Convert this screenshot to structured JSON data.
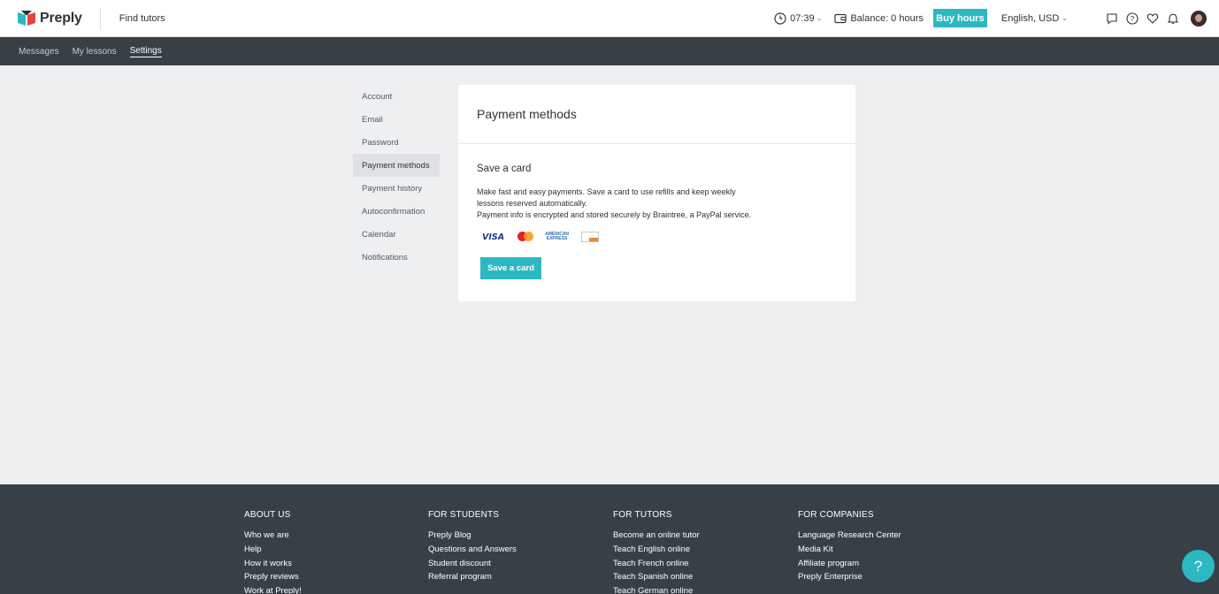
{
  "header": {
    "brand": "Preply",
    "find_tutors": "Find tutors",
    "time": "07:39",
    "balance": "Balance: 0 hours",
    "buy_hours": "Buy hours",
    "language": "English, USD"
  },
  "subnav": {
    "items": [
      "Messages",
      "My lessons",
      "Settings"
    ],
    "active": "Settings"
  },
  "sidebar": {
    "items": [
      "Account",
      "Email",
      "Password",
      "Payment methods",
      "Payment history",
      "Autoconfirmation",
      "Calendar",
      "Notifications"
    ],
    "active": "Payment methods"
  },
  "card": {
    "title": "Payment methods",
    "section_title": "Save a card",
    "description_line1": "Make fast and easy payments. Save a card to use refills and keep weekly",
    "description_line2": "lessons reserved automatically.",
    "description_line3": "Payment info is encrypted and stored securely by Braintree, a PayPal service.",
    "card_logos": [
      "VISA",
      "Mastercard",
      "American Express",
      "Discover"
    ],
    "visa_text": "VISA",
    "amex_line1": "AMERICAN",
    "amex_line2": "EXPRESS",
    "save_button": "Save a card"
  },
  "footer": {
    "columns": [
      {
        "heading": "ABOUT US",
        "links": [
          "Who we are",
          "Help",
          "How it works",
          "Preply reviews",
          "Work at Preply!"
        ]
      },
      {
        "heading": "FOR STUDENTS",
        "links": [
          "Preply Blog",
          "Questions and Answers",
          "Student discount",
          "Referral program"
        ]
      },
      {
        "heading": "FOR TUTORS",
        "links": [
          "Become an online tutor",
          "Teach English online",
          "Teach French online",
          "Teach Spanish online",
          "Teach German online"
        ]
      },
      {
        "heading": "FOR COMPANIES",
        "links": [
          "Language Research Center",
          "Media Kit",
          "Affiliate program",
          "Preply Enterprise"
        ]
      }
    ]
  },
  "help_bubble": "?",
  "colors": {
    "accent": "#2cb8c2",
    "nav_bg": "#384047",
    "page_bg": "#eeeff1"
  },
  "icons": [
    "clock-icon",
    "wallet-icon",
    "chat-icon",
    "help-icon",
    "heart-icon",
    "bell-icon"
  ]
}
